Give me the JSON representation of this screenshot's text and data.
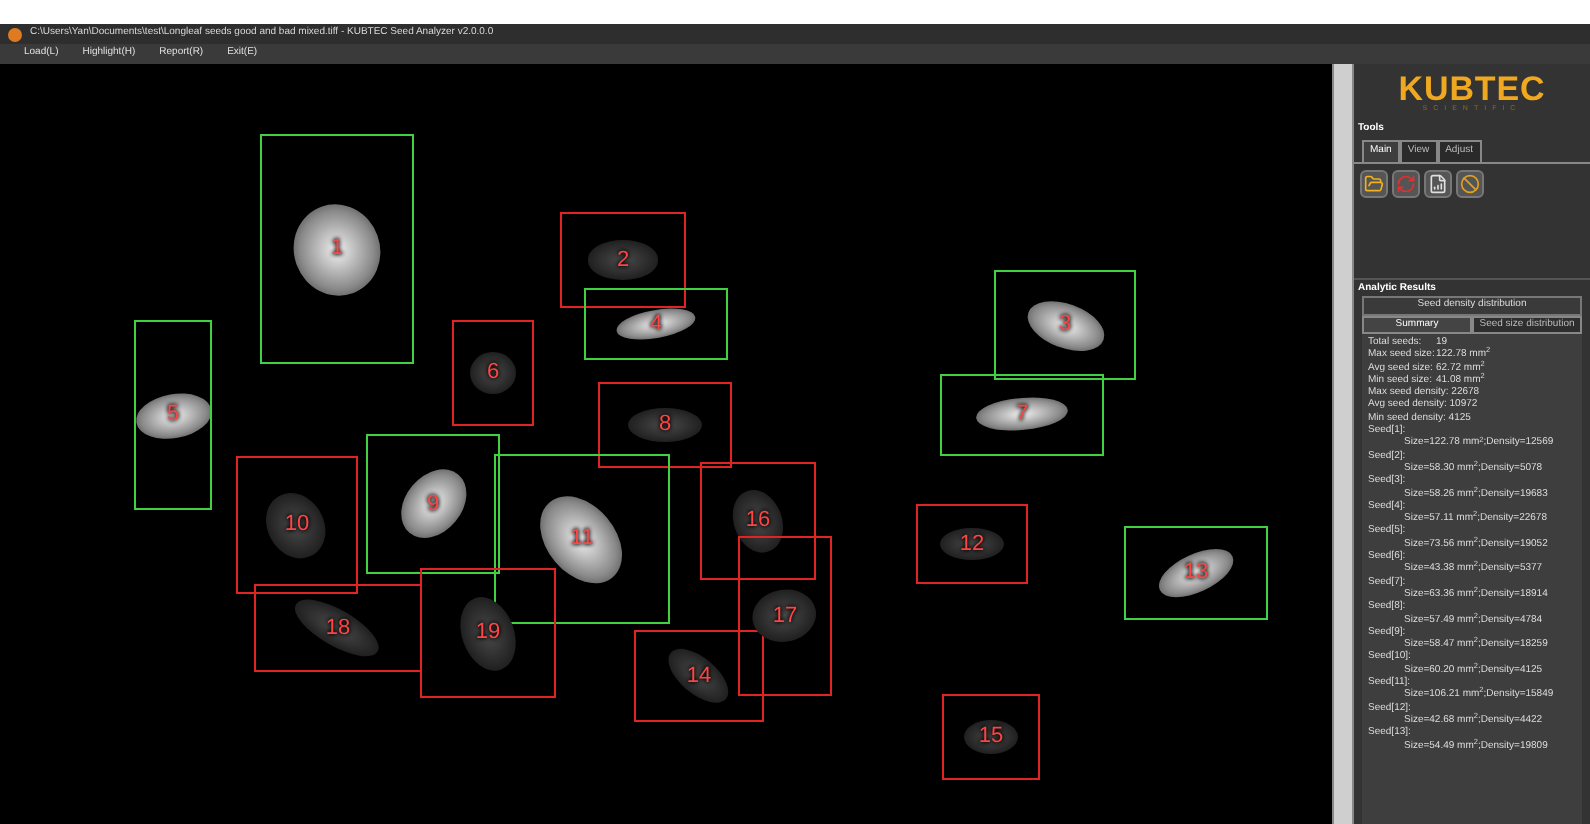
{
  "window": {
    "title": "C:\\Users\\Yan\\Documents\\test\\Longleaf seeds good and bad mixed.tiff - KUBTEC Seed Analyzer v2.0.0.0"
  },
  "menu": [
    "Load(L)",
    "Highlight(H)",
    "Report(R)",
    "Exit(E)"
  ],
  "seeds": [
    {
      "label": "1",
      "color": "#3fd13f"
    },
    {
      "label": "2",
      "color": "#e02424"
    },
    {
      "label": "3",
      "color": "#3fd13f"
    },
    {
      "label": "4",
      "color": "#3fd13f"
    },
    {
      "label": "5",
      "color": "#3fd13f"
    },
    {
      "label": "6",
      "color": "#e02424"
    },
    {
      "label": "7",
      "color": "#3fd13f"
    },
    {
      "label": "8",
      "color": "#e02424"
    },
    {
      "label": "9",
      "color": "#3fd13f"
    },
    {
      "label": "10",
      "color": "#e02424"
    },
    {
      "label": "11",
      "color": "#3fd13f"
    },
    {
      "label": "12",
      "color": "#e02424"
    },
    {
      "label": "13",
      "color": "#3fd13f"
    },
    {
      "label": "14",
      "color": "#e02424"
    },
    {
      "label": "15",
      "color": "#e02424"
    },
    {
      "label": "16",
      "color": "#e02424"
    },
    {
      "label": "17",
      "color": "#e02424"
    },
    {
      "label": "18",
      "color": "#e02424"
    },
    {
      "label": "19",
      "color": "#e02424"
    }
  ],
  "logo": {
    "name": "KUBTEC",
    "tagline": "SCIENTIFIC"
  },
  "tools": {
    "title": "Tools",
    "tabs": [
      {
        "label": "Main",
        "selected": true
      },
      {
        "label": "View",
        "selected": false
      },
      {
        "label": "Adjust",
        "selected": false
      }
    ]
  },
  "results": {
    "title": "Analytic Results",
    "top_tab": "Seed density distribution",
    "tabs": [
      {
        "label": "Summary",
        "selected": true
      },
      {
        "label": "Seed size distribution",
        "selected": false
      }
    ],
    "summary": [
      [
        "Total seeds:",
        "19"
      ],
      [
        "Max seed size:",
        "122.78 mm$^{2}$"
      ],
      [
        "Avg seed size:",
        "62.72 mm$^{2}$"
      ],
      [
        "Min seed size:",
        "41.08 mm$^{2}$"
      ]
    ],
    "stats": [
      "Max seed density: 22678",
      "Avg seed density: 10972",
      "Min seed density: 4125"
    ],
    "seeds": [
      {
        "name": "Seed[1]:",
        "detail": "Size=122.78 mm$^{2}$;Density=12569"
      },
      {
        "name": "Seed[2]:",
        "detail": "Size=58.30 mm$^{2}$;Density=5078"
      },
      {
        "name": "Seed[3]:",
        "detail": "Size=58.26 mm$^{2}$;Density=19683"
      },
      {
        "name": "Seed[4]:",
        "detail": "Size=57.11 mm$^{2}$;Density=22678"
      },
      {
        "name": "Seed[5]:",
        "detail": "Size=73.56 mm$^{2}$;Density=19052"
      },
      {
        "name": "Seed[6]:",
        "detail": "Size=43.38 mm$^{2}$;Density=5377"
      },
      {
        "name": "Seed[7]:",
        "detail": "Size=63.36 mm$^{2}$;Density=18914"
      },
      {
        "name": "Seed[8]:",
        "detail": "Size=57.49 mm$^{2}$;Density=4784"
      },
      {
        "name": "Seed[9]:",
        "detail": "Size=58.47 mm$^{2}$;Density=18259"
      },
      {
        "name": "Seed[10]:",
        "detail": "Size=60.20 mm$^{2}$;Density=4125"
      },
      {
        "name": "Seed[11]:",
        "detail": "Size=106.21 mm$^{2}$;Density=15849"
      },
      {
        "name": "Seed[12]:",
        "detail": "Size=42.68 mm$^{2}$;Density=4422"
      },
      {
        "name": "Seed[13]:",
        "detail": "Size=54.49 mm$^{2}$;Density=19809"
      }
    ]
  }
}
